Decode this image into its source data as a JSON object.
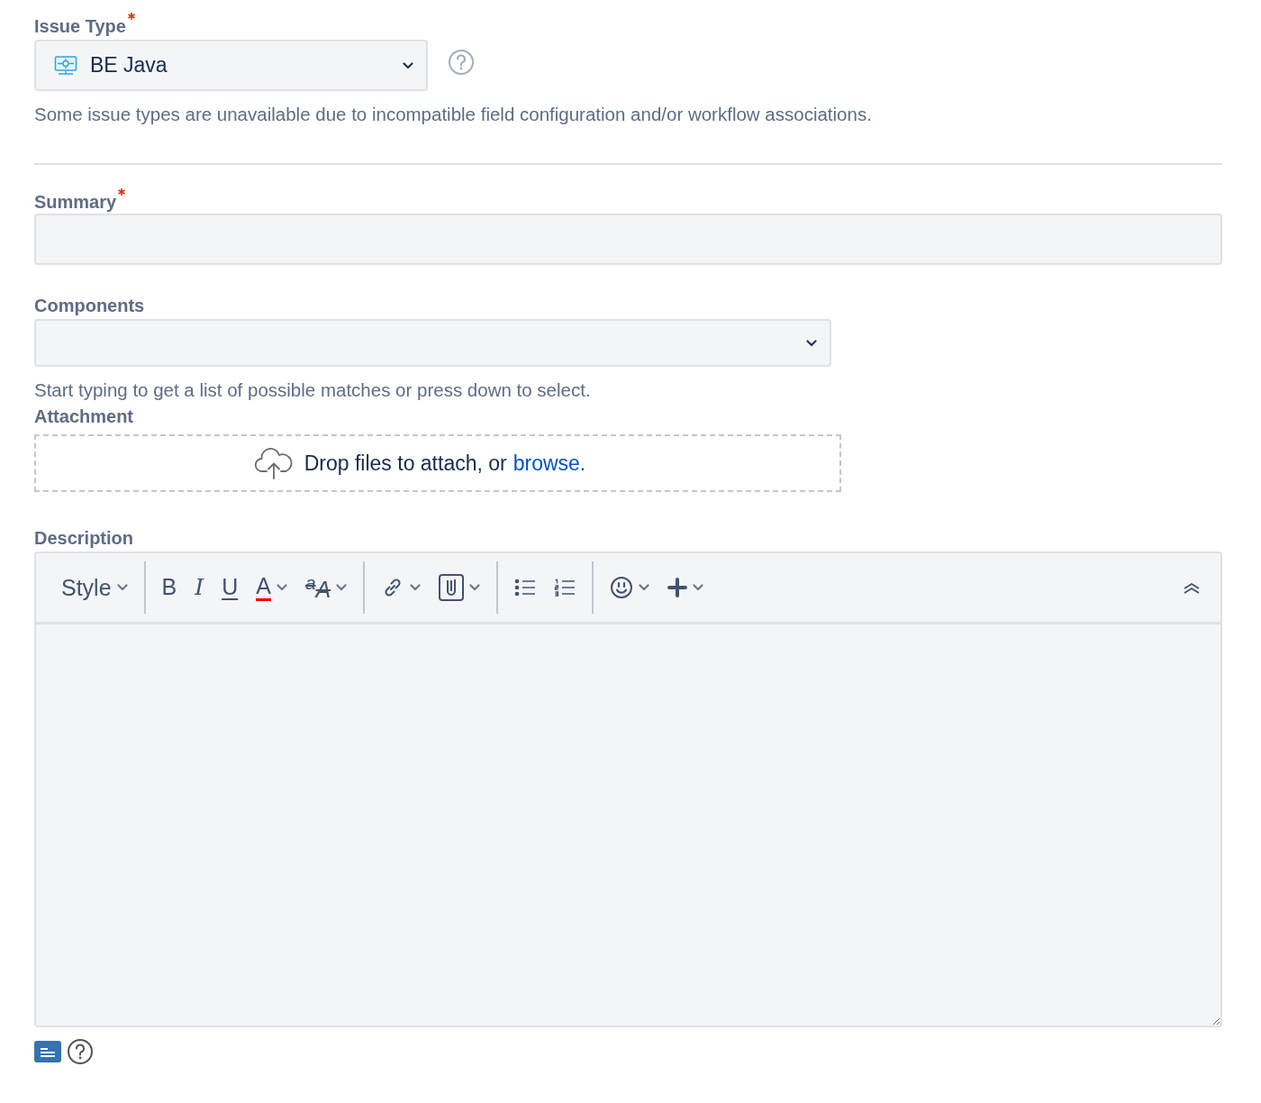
{
  "issue_type": {
    "label": "Issue Type",
    "required": true,
    "value": "BE Java",
    "help": "Some issue types are unavailable due to incompatible field configuration and/or workflow associations."
  },
  "summary": {
    "label": "Summary",
    "required": true
  },
  "components": {
    "label": "Components",
    "required": false,
    "help": "Start typing to get a list of possible matches or press down to select."
  },
  "attachment": {
    "label": "Attachment",
    "text": "Drop files to attach, or",
    "link": "browse."
  },
  "description": {
    "label": "Description",
    "toolbar": [
      [
        {
          "kind": "style",
          "label": "Style",
          "dropdown": true
        }
      ],
      [
        {
          "kind": "bold",
          "label": "B",
          "dropdown": false
        },
        {
          "kind": "italic",
          "label": "I",
          "dropdown": false
        },
        {
          "kind": "underline",
          "label": "U",
          "dropdown": false
        },
        {
          "kind": "color",
          "label": "A",
          "dropdown": true
        },
        {
          "kind": "size",
          "label": "$^{a}$A",
          "dropdown": true
        }
      ],
      [
        {
          "kind": "link",
          "dropdown": true
        },
        {
          "kind": "attachment",
          "dropdown": true
        }
      ],
      [
        {
          "kind": "bullet-list",
          "dropdown": false
        },
        {
          "kind": "numbered-list",
          "dropdown": false
        }
      ],
      [
        {
          "kind": "emoji",
          "dropdown": true
        },
        {
          "kind": "insert",
          "dropdown": true
        }
      ]
    ]
  }
}
